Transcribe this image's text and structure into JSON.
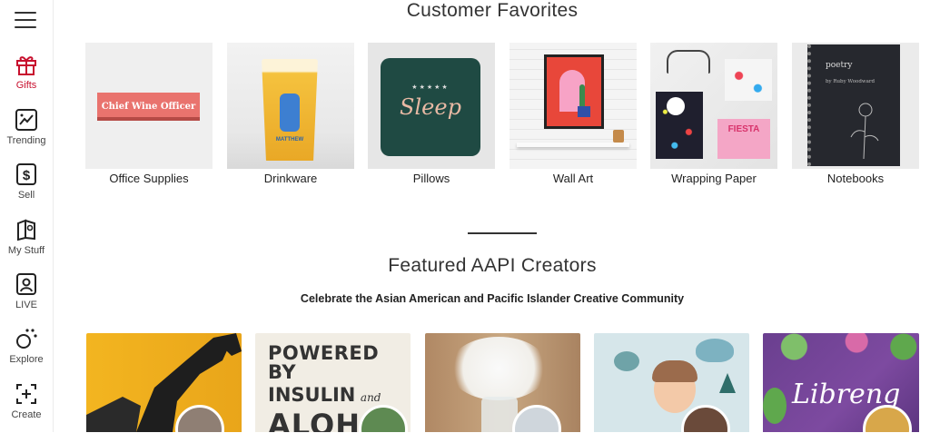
{
  "sidebar": {
    "items": [
      {
        "label": "Gifts",
        "icon": "gift-icon",
        "active": true
      },
      {
        "label": "Trending",
        "icon": "trending-icon",
        "active": false
      },
      {
        "label": "Sell",
        "icon": "dollar-icon",
        "active": false
      },
      {
        "label": "My Stuff",
        "icon": "my-stuff-icon",
        "active": false
      },
      {
        "label": "LIVE",
        "icon": "live-icon",
        "active": false
      },
      {
        "label": "Explore",
        "icon": "explore-icon",
        "active": false
      },
      {
        "label": "Create",
        "icon": "create-icon",
        "active": false
      }
    ],
    "active_color": "#c8102e"
  },
  "favorites": {
    "title": "Customer Favorites",
    "categories": [
      {
        "label": "Office Supplies",
        "image_text": "Chief Wine Officer"
      },
      {
        "label": "Drinkware",
        "image_text": "MATTHEW"
      },
      {
        "label": "Pillows",
        "image_text": "Sleep"
      },
      {
        "label": "Wall Art"
      },
      {
        "label": "Wrapping Paper",
        "image_text": "FIESTA"
      },
      {
        "label": "Notebooks",
        "image_text": "poetry",
        "image_subtext": "by Ruby Woodward"
      }
    ]
  },
  "creators": {
    "title": "Featured AAPI Creators",
    "subtitle": "Celebrate the Asian American and Pacific Islander Creative Community",
    "cards": [
      {
        "image_text": ""
      },
      {
        "image_text": "POWERED BY",
        "image_text2": "INSULIN",
        "image_text3": "and",
        "image_text4": "ALOHA"
      },
      {
        "image_text": ""
      },
      {
        "image_text": ""
      },
      {
        "image_text": "Libreng"
      }
    ]
  }
}
